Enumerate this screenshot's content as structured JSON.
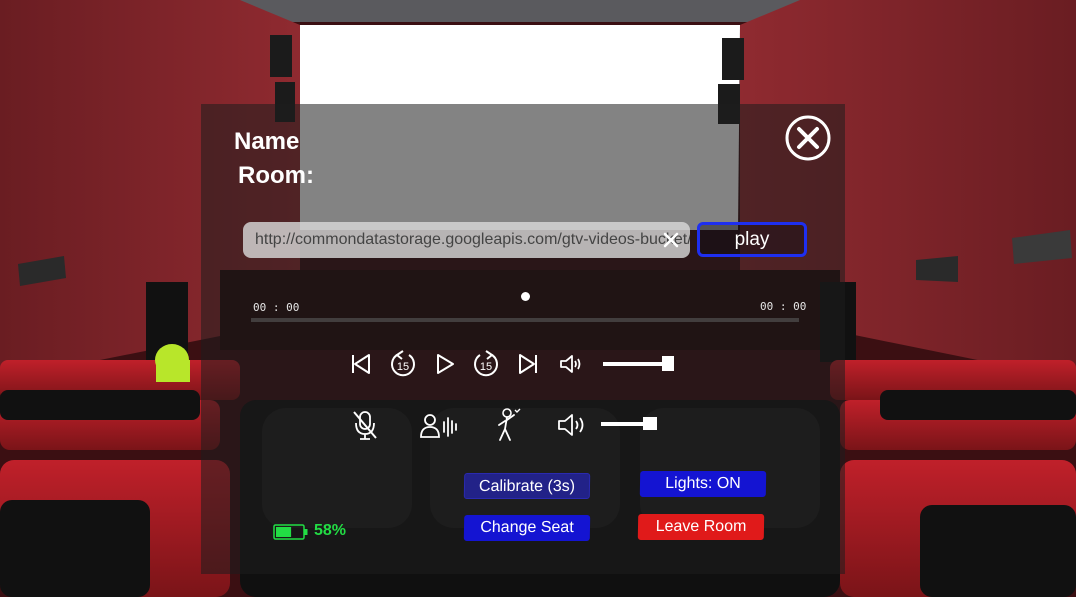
{
  "user": {
    "name_label": "Name",
    "room_label": "Room:"
  },
  "media": {
    "url_value": "http://commondatastorage.googleapis.com/gtv-videos-bucket/",
    "play_label": "play",
    "current_time": "00 : 00",
    "total_time": "00 : 00",
    "progress": 0.5,
    "media_volume": 0.95,
    "skip_back_seconds": "15",
    "skip_forward_seconds": "15"
  },
  "voice": {
    "volume": 0.9
  },
  "buttons": {
    "calibrate": "Calibrate (3s)",
    "lights": "Lights: ON",
    "change_seat": "Change Seat",
    "leave_room": "Leave Room"
  },
  "battery": {
    "percent_text": "58%",
    "level": 0.58
  },
  "colors": {
    "accent_blue": "#1e2ff0",
    "button_blue": "#1414d2",
    "calibrate_blue": "#222288",
    "leave_red": "#e01a1a",
    "battery_green": "#22dd44"
  },
  "icons": {
    "close": "close-circle-icon",
    "clear": "clear-x-icon",
    "skip_start": "skip-to-start-icon",
    "rewind": "rewind-15-icon",
    "play": "play-icon",
    "forward": "forward-15-icon",
    "skip_end": "skip-to-end-icon",
    "speaker": "speaker-icon",
    "mic_off": "microphone-muted-icon",
    "voice": "voice-chat-icon",
    "dance": "dancing-figure-icon",
    "battery": "battery-icon"
  }
}
